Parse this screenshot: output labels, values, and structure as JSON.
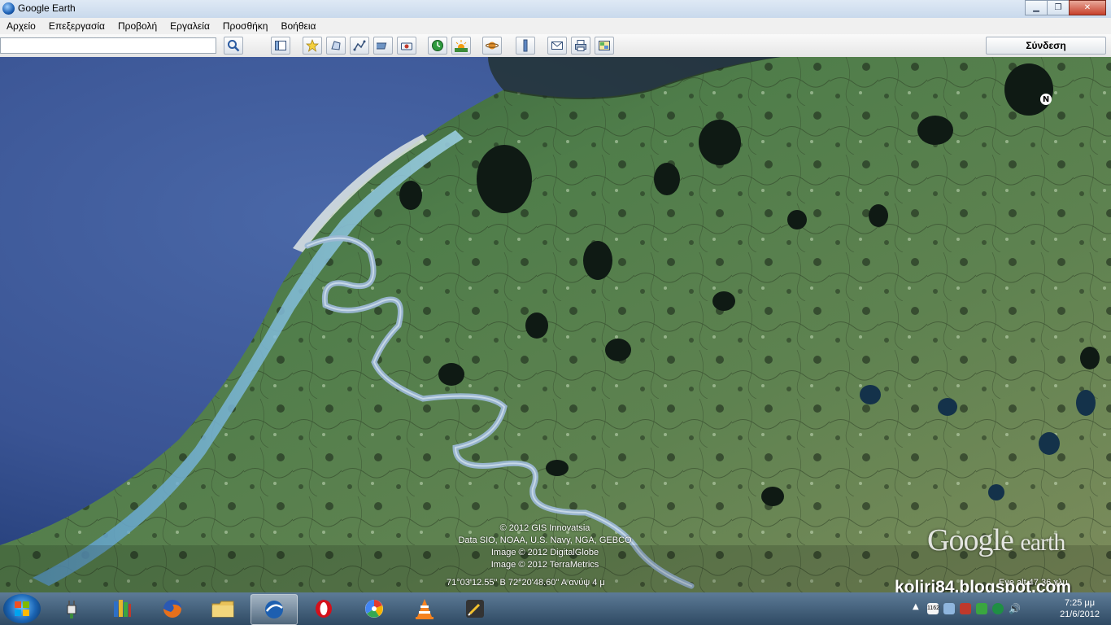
{
  "window": {
    "title": "Google Earth"
  },
  "menu": {
    "items": [
      "Αρχείο",
      "Επεξεργασία",
      "Προβολή",
      "Εργαλεία",
      "Προσθήκη",
      "Βοήθεια"
    ]
  },
  "toolbar": {
    "search_value": "",
    "signin_label": "Σύνδεση"
  },
  "map": {
    "nav_marker": "Ν",
    "attribution": [
      "© 2012 GIS Innovatsia",
      "Data SIO, NOAA, U.S. Navy, NGA, GEBCO",
      "Image © 2012 DigitalGlobe",
      "Image © 2012 TerraMetrics"
    ],
    "coordinates": "71°03'12.55\" Β  72°20'48.60\" Α ανύψ     4 μ",
    "eye_alt": "Eye alt    47.36 χλμ",
    "logo": {
      "brand": "Google",
      "product": "earth"
    },
    "watermark": "koliri84.blogspot.com"
  },
  "taskbar": {
    "apps": [
      "plugin-icon",
      "books-icon",
      "firefox-icon",
      "folder-icon",
      "google-earth-icon",
      "opera-icon",
      "picasa-icon",
      "vlc-icon",
      "editor-icon"
    ],
    "tray_badge": "1162",
    "clock_time": "7:25 μμ",
    "clock_date": "21/6/2012"
  }
}
